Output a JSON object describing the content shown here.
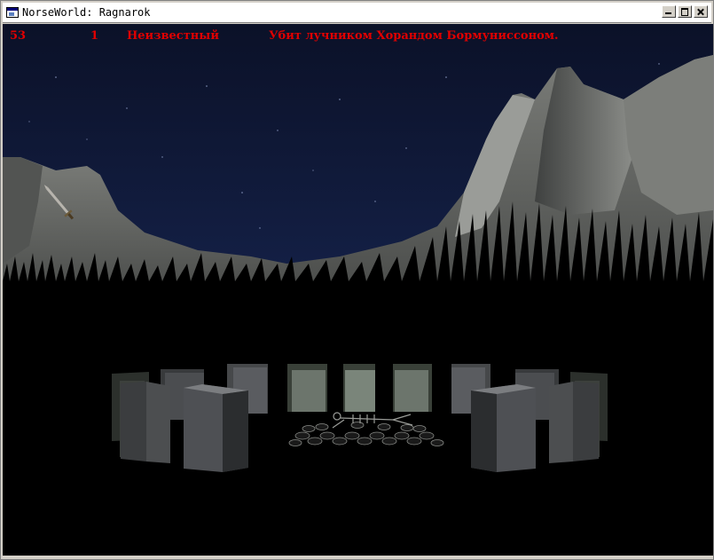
{
  "window": {
    "title": "NorseWorld: Ragnarok"
  },
  "hud": {
    "score": "53",
    "lives": "1",
    "name": "Неизвестный",
    "message": "Убит лучником Хорандом Бормуниссоном."
  },
  "colors": {
    "sky": "#0d1530",
    "mountain": "#6e706c",
    "ground": "#000000",
    "hud_text": "#e00000",
    "stone_dark": "#3a3a3a",
    "stone_light": "#8c948c"
  }
}
